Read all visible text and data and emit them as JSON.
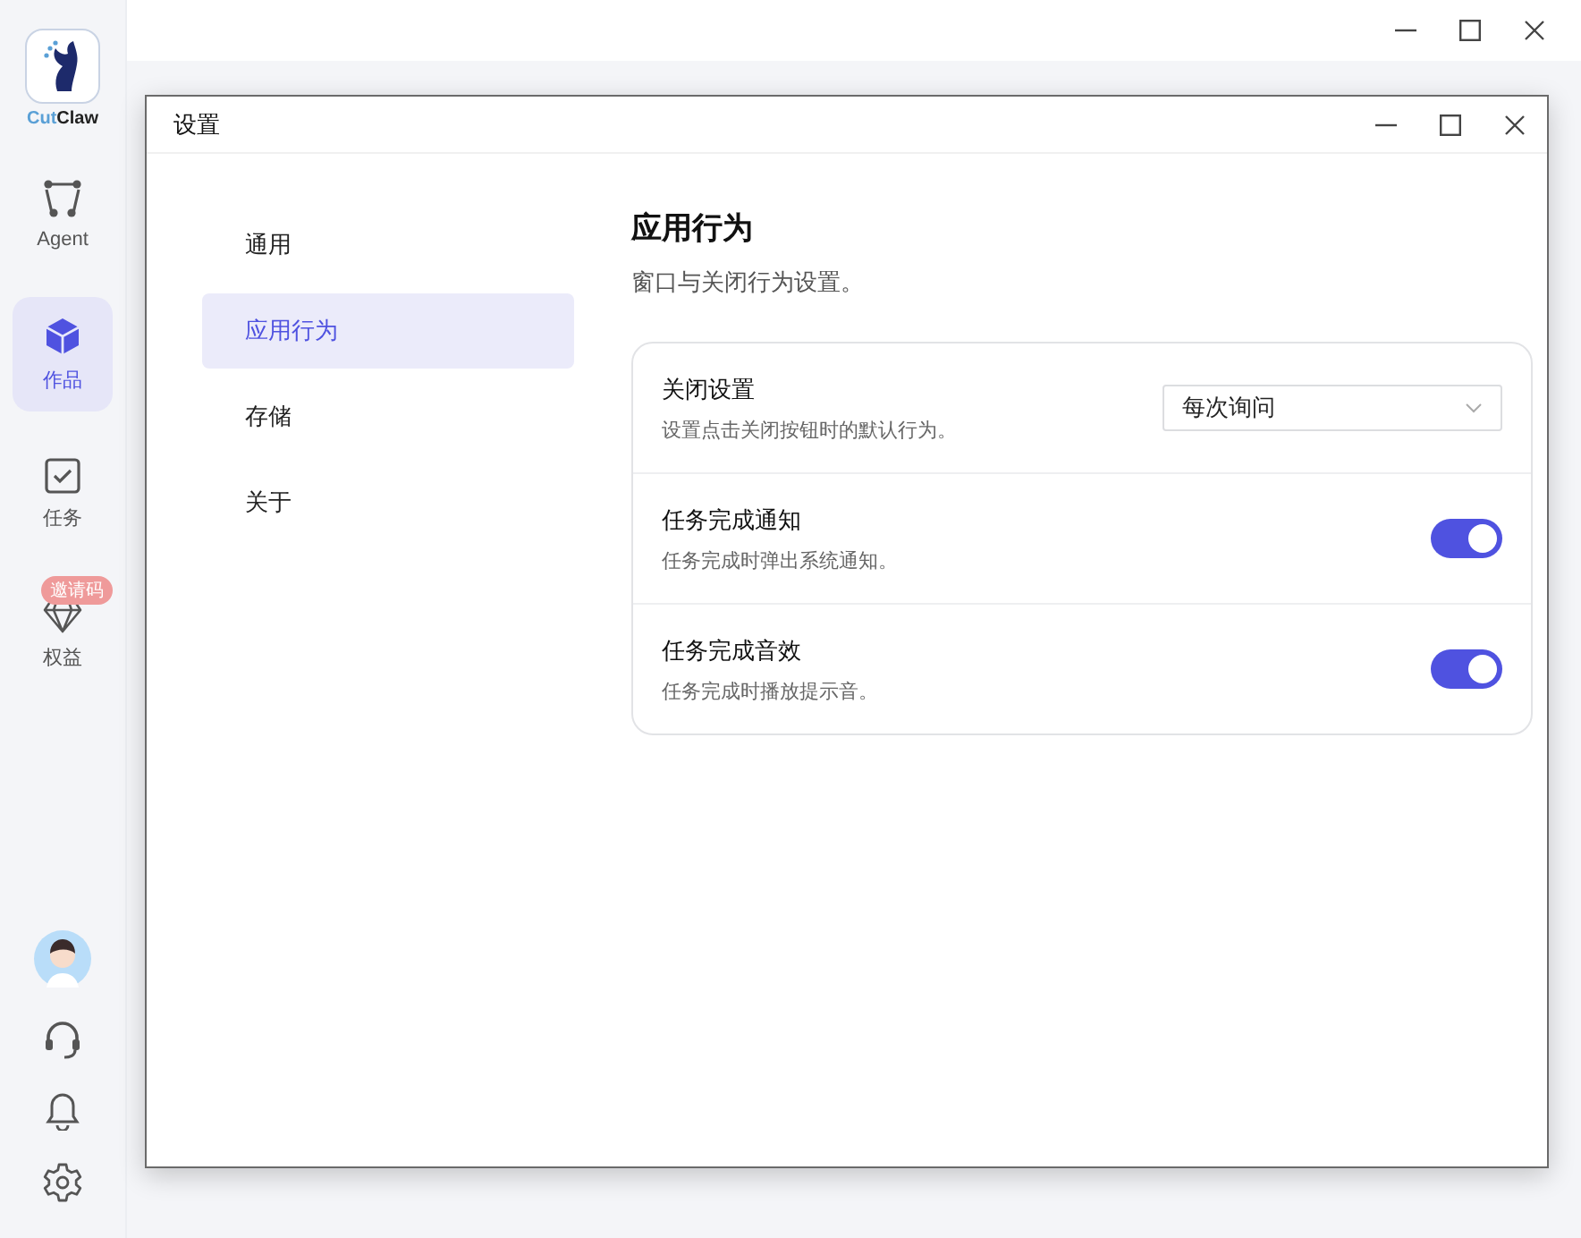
{
  "logo": {
    "brand_first": "Cut",
    "brand_second": "Claw"
  },
  "nav": [
    {
      "label": "Agent",
      "selected": false
    },
    {
      "label": "作品",
      "selected": true
    },
    {
      "label": "任务",
      "selected": false
    },
    {
      "label": "权益",
      "selected": false,
      "badge": "邀请码"
    }
  ],
  "dialog": {
    "title": "设置",
    "menu": [
      {
        "label": "通用",
        "selected": false
      },
      {
        "label": "应用行为",
        "selected": true
      },
      {
        "label": "存储",
        "selected": false
      },
      {
        "label": "关于",
        "selected": false
      }
    ],
    "section": {
      "title": "应用行为",
      "subtitle": "窗口与关闭行为设置。"
    },
    "settings": [
      {
        "kind": "select",
        "title": "关闭设置",
        "description": "设置点击关闭按钮时的默认行为。",
        "value": "每次询问"
      },
      {
        "kind": "toggle",
        "title": "任务完成通知",
        "description": "任务完成时弹出系统通知。",
        "on": true
      },
      {
        "kind": "toggle",
        "title": "任务完成音效",
        "description": "任务完成时播放提示音。",
        "on": true
      }
    ]
  }
}
